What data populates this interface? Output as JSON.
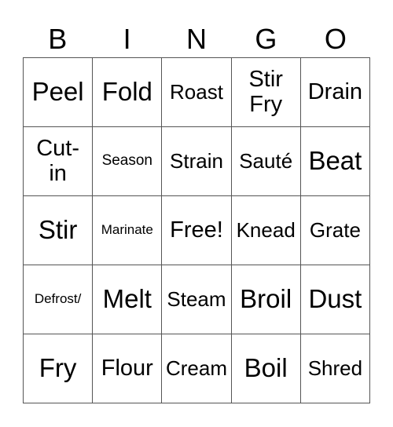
{
  "header": [
    "B",
    "I",
    "N",
    "G",
    "O"
  ],
  "cells": [
    [
      "Peel",
      "Fold",
      "Roast",
      "Stir Fry",
      "Drain"
    ],
    [
      "Cut-in",
      "Season",
      "Strain",
      "Sauté",
      "Beat"
    ],
    [
      "Stir",
      "Marinate",
      "Free!",
      "Knead",
      "Grate"
    ],
    [
      "Defrost/",
      "Melt",
      "Steam",
      "Broil",
      "Dust"
    ],
    [
      "Fry",
      "Flour",
      "Cream",
      "Boil",
      "Shred"
    ]
  ]
}
